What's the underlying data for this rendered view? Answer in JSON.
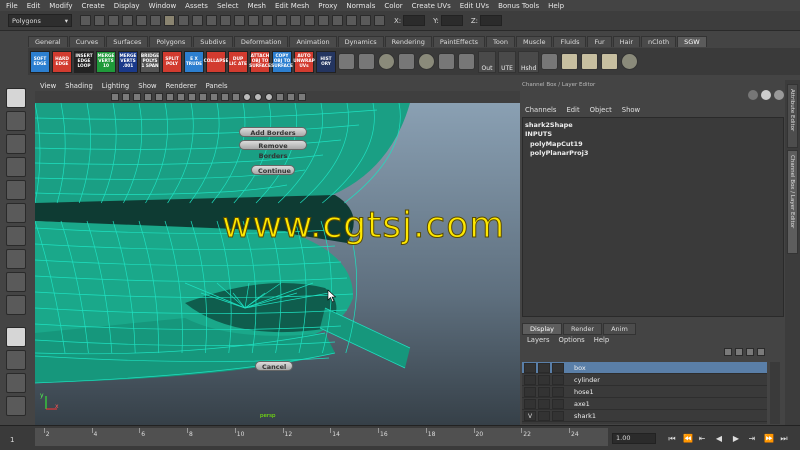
{
  "menubar": [
    "File",
    "Edit",
    "Modify",
    "Create",
    "Display",
    "Window",
    "Assets",
    "Select",
    "Mesh",
    "Edit Mesh",
    "Proxy",
    "Normals",
    "Color",
    "Create UVs",
    "Edit UVs",
    "Bonus Tools",
    "Help"
  ],
  "statusline": {
    "mode": "Polygons",
    "x_label": "X:",
    "y_label": "Y:",
    "z_label": "Z:"
  },
  "shelf_tabs": [
    "General",
    "Curves",
    "Surfaces",
    "Polygons",
    "Subdivs",
    "Deformation",
    "Animation",
    "Dynamics",
    "Rendering",
    "PaintEffects",
    "Toon",
    "Muscle",
    "Fluids",
    "Fur",
    "Hair",
    "nCloth",
    "SGW"
  ],
  "shelf_active_tab": "SGW",
  "shelf_buttons": [
    {
      "label": "SOFT EDGE",
      "color": "blue"
    },
    {
      "label": "HARD EDGE",
      "color": "red"
    },
    {
      "label": "INSERT EDGE LOOP",
      "color": "dark"
    },
    {
      "label": "MERGE VERTS 10",
      "color": "green"
    },
    {
      "label": "MERGE VERTS .001",
      "color": "darkblue"
    },
    {
      "label": "BRIDGE POLYS 1 SPAN",
      "color": "gray"
    },
    {
      "label": "SPLIT POLY",
      "color": "red"
    },
    {
      "label": "E X TRUDE",
      "color": "blue"
    },
    {
      "label": "COLLAPSE",
      "color": "red"
    },
    {
      "label": "DUP LIC ATE",
      "color": "red"
    },
    {
      "label": "ATTACH OBJ TO SURFACE",
      "color": "red"
    },
    {
      "label": "COPY OBJ TO SURFACE",
      "color": "blue"
    },
    {
      "label": "AUTO UNWRAP UVs",
      "color": "red"
    },
    {
      "label": "HIST ORY",
      "color": "navy"
    }
  ],
  "shelf_text_buttons": [
    "Out",
    "UTE",
    "Hshd"
  ],
  "viewport_menu": [
    "View",
    "Shading",
    "Lighting",
    "Show",
    "Renderer",
    "Panels"
  ],
  "marking_menu": {
    "add_borders": "Add Borders",
    "remove_borders": "Remove Borders",
    "continue": "Continue",
    "cancel": "Cancel"
  },
  "watermark": "www.cgtsj.com",
  "viewport_camera": "persp",
  "axis": {
    "x": "x",
    "y": "y"
  },
  "right_panel": {
    "title": "Channel Box / Layer Editor",
    "channel_menu": [
      "Channels",
      "Edit",
      "Object",
      "Show"
    ],
    "shape_name": "shark2Shape",
    "inputs_label": "INPUTS",
    "inputs": [
      "polyMapCut19",
      "polyPlanarProj3"
    ]
  },
  "layer_editor": {
    "tabs": [
      "Display",
      "Render",
      "Anim"
    ],
    "active_tab": "Display",
    "menu": [
      "Layers",
      "Options",
      "Help"
    ],
    "layers": [
      {
        "name": "box",
        "visible": "",
        "selected": true
      },
      {
        "name": "cylinder",
        "visible": "",
        "selected": false
      },
      {
        "name": "hose1",
        "visible": "",
        "selected": false
      },
      {
        "name": "axe1",
        "visible": "",
        "selected": false
      },
      {
        "name": "shark1",
        "visible": "V",
        "selected": false
      }
    ]
  },
  "side_tabs": [
    "Attribute Editor",
    "Channel Box / Layer Editor"
  ],
  "timeline": {
    "start": "1",
    "ticks": [
      "2",
      "4",
      "6",
      "8",
      "10",
      "12",
      "14",
      "16",
      "18",
      "20",
      "22",
      "24"
    ],
    "current_time": "1.00"
  },
  "colors": {
    "mesh": "#1aa88a",
    "wire": "#1ee0c0",
    "watermark": "#ffe800"
  }
}
